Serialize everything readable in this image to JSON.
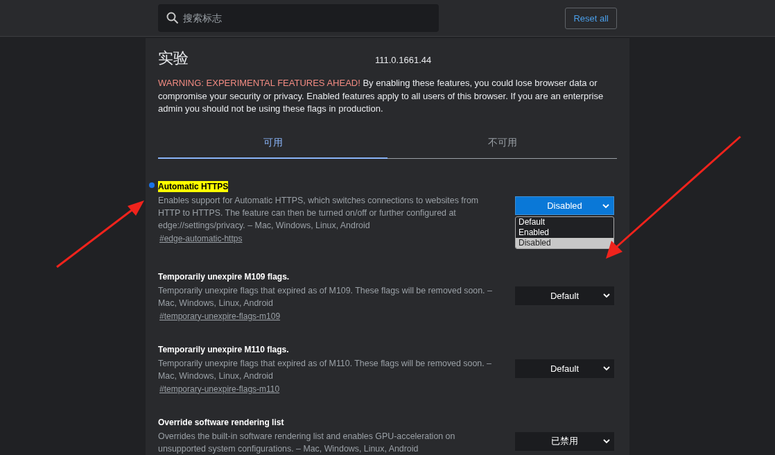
{
  "search": {
    "placeholder": "搜索标志"
  },
  "reset_button": "Reset all",
  "title": "实验",
  "version": "111.0.1661.44",
  "warning": {
    "label": "WARNING: EXPERIMENTAL FEATURES AHEAD!",
    "text": "By enabling these features, you could lose browser data or compromise your security or privacy. Enabled features apply to all users of this browser. If you are an enterprise admin you should not be using these flags in production."
  },
  "tabs": [
    {
      "label": "可用",
      "selected": true
    },
    {
      "label": "不可用",
      "selected": false
    }
  ],
  "flags": [
    {
      "title": "Automatic HTTPS",
      "highlighted": true,
      "modified": true,
      "description": "Enables support for Automatic HTTPS, which switches connections to websites from HTTP to HTTPS. The feature can then be turned on/off or further configured at edge://settings/privacy. – Mac, Windows, Linux, Android",
      "link": "#edge-automatic-https",
      "value": "Disabled",
      "options": [
        {
          "label": "Default",
          "selected": false
        },
        {
          "label": "Enabled",
          "selected": false
        },
        {
          "label": "Disabled",
          "selected": true
        }
      ]
    },
    {
      "title": "Temporarily unexpire M109 flags.",
      "highlighted": false,
      "modified": false,
      "description": "Temporarily unexpire flags that expired as of M109. These flags will be removed soon. – Mac, Windows, Linux, Android",
      "link": "#temporary-unexpire-flags-m109",
      "value": "Default"
    },
    {
      "title": "Temporarily unexpire M110 flags.",
      "highlighted": false,
      "modified": false,
      "description": "Temporarily unexpire flags that expired as of M110. These flags will be removed soon. – Mac, Windows, Linux, Android",
      "link": "#temporary-unexpire-flags-m110",
      "value": "Default"
    },
    {
      "title": "Override software rendering list",
      "highlighted": false,
      "modified": false,
      "description": "Overrides the built-in software rendering list and enables GPU-acceleration on unsupported system configurations. – Mac, Windows, Linux, Android",
      "value": "已禁用"
    }
  ]
}
